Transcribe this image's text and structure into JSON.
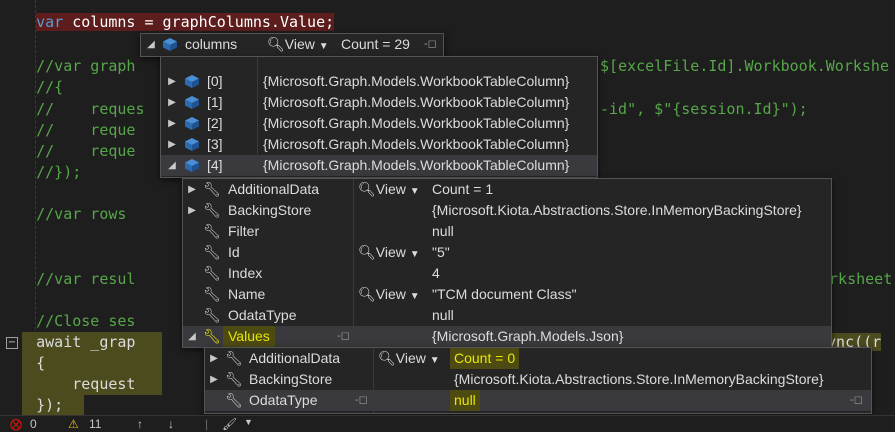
{
  "code_lines": [
    {
      "id": "l0",
      "text": "    var columns = graphColumns.Value;"
    },
    {
      "id": "l1",
      "text": "    //var graph"
    },
    {
      "id": "l1r",
      "text": "$[excelFile.Id].Workbook.Workshe"
    },
    {
      "id": "l2",
      "text": "    //{"
    },
    {
      "id": "l3",
      "text": "    //    reques"
    },
    {
      "id": "l3r",
      "text": "-id\", $\"{session.Id}\");"
    },
    {
      "id": "l4",
      "text": "    //    reque"
    },
    {
      "id": "l5",
      "text": "    //    reque"
    },
    {
      "id": "l6",
      "text": "    //});"
    },
    {
      "id": "l7",
      "text": "    //var rows"
    },
    {
      "id": "l8",
      "text": "    //var resul"
    },
    {
      "id": "l8r",
      "text": "orksheet"
    },
    {
      "id": "l9",
      "text": "    //Close ses"
    },
    {
      "id": "l10",
      "text": "    await _grap"
    },
    {
      "id": "l10r",
      "text": "sync((r"
    },
    {
      "id": "l11",
      "text": "    {"
    },
    {
      "id": "l12",
      "text": "        request"
    },
    {
      "id": "l13",
      "text": "    });"
    }
  ],
  "tip_columns": {
    "name": "columns",
    "view_label": "View",
    "value": "Count = 29",
    "pin_icon": "pin-icon"
  },
  "items_panel": {
    "rows": [
      {
        "name": "[0]",
        "value": "{Microsoft.Graph.Models.WorkbookTableColumn}"
      },
      {
        "name": "[1]",
        "value": "{Microsoft.Graph.Models.WorkbookTableColumn}"
      },
      {
        "name": "[2]",
        "value": "{Microsoft.Graph.Models.WorkbookTableColumn}"
      },
      {
        "name": "[3]",
        "value": "{Microsoft.Graph.Models.WorkbookTableColumn}"
      },
      {
        "name": "[4]",
        "value": "{Microsoft.Graph.Models.WorkbookTableColumn}"
      }
    ]
  },
  "props_panel": {
    "rows": [
      {
        "name": "AdditionalData",
        "view": "View",
        "value": "Count = 1"
      },
      {
        "name": "BackingStore",
        "view": "",
        "value": "{Microsoft.Kiota.Abstractions.Store.InMemoryBackingStore}"
      },
      {
        "name": "Filter",
        "view": "",
        "value": "null"
      },
      {
        "name": "Id",
        "view": "View",
        "value": "\"5\""
      },
      {
        "name": "Index",
        "view": "",
        "value": "4"
      },
      {
        "name": "Name",
        "view": "View",
        "value": "\"TCM document  Class\""
      },
      {
        "name": "OdataType",
        "view": "",
        "value": "null"
      },
      {
        "name": "Values",
        "view": "",
        "value": "{Microsoft.Graph.Models.Json}"
      }
    ]
  },
  "values_panel": {
    "rows": [
      {
        "name": "AdditionalData",
        "view": "View",
        "value": "Count = 0"
      },
      {
        "name": "BackingStore",
        "view": "",
        "value": "{Microsoft.Kiota.Abstractions.Store.InMemoryBackingStore}"
      },
      {
        "name": "OdataType",
        "view": "",
        "value": "null"
      }
    ]
  },
  "status_bar": {
    "errors": "0",
    "warnings": "11"
  },
  "colors": {
    "comment": "#57a64a",
    "keyword": "#569cd6",
    "selection_highlight": "#4d4a12",
    "statement_highlight": "#5d1d1d"
  }
}
